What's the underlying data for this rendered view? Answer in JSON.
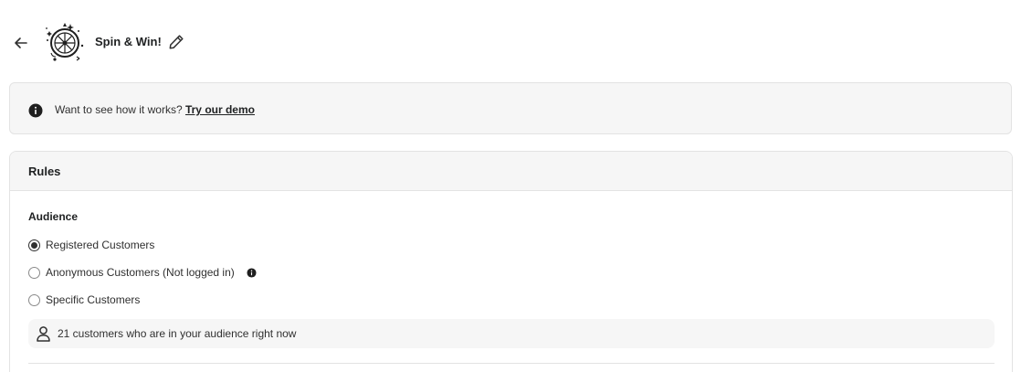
{
  "header": {
    "back_icon": "arrow-left-icon",
    "logo_icon": "spin-wheel-icon",
    "title": "Spin & Win!",
    "edit_icon": "pencil-icon"
  },
  "banner": {
    "icon": "info-icon",
    "text": "Want to see how it works?",
    "link": "Try our demo"
  },
  "rules": {
    "title": "Rules",
    "audience_label": "Audience",
    "options": [
      {
        "label": "Registered Customers",
        "selected": true
      },
      {
        "label": "Anonymous Customers (Not logged in)",
        "selected": false,
        "has_info": true
      },
      {
        "label": "Specific Customers",
        "selected": false
      }
    ],
    "audience_summary": {
      "icon": "person-icon",
      "text": "21 customers who are in your audience right now"
    }
  },
  "colors": {
    "text": "#303030",
    "surface": "#f6f6f6",
    "border": "#e3e3e3"
  }
}
